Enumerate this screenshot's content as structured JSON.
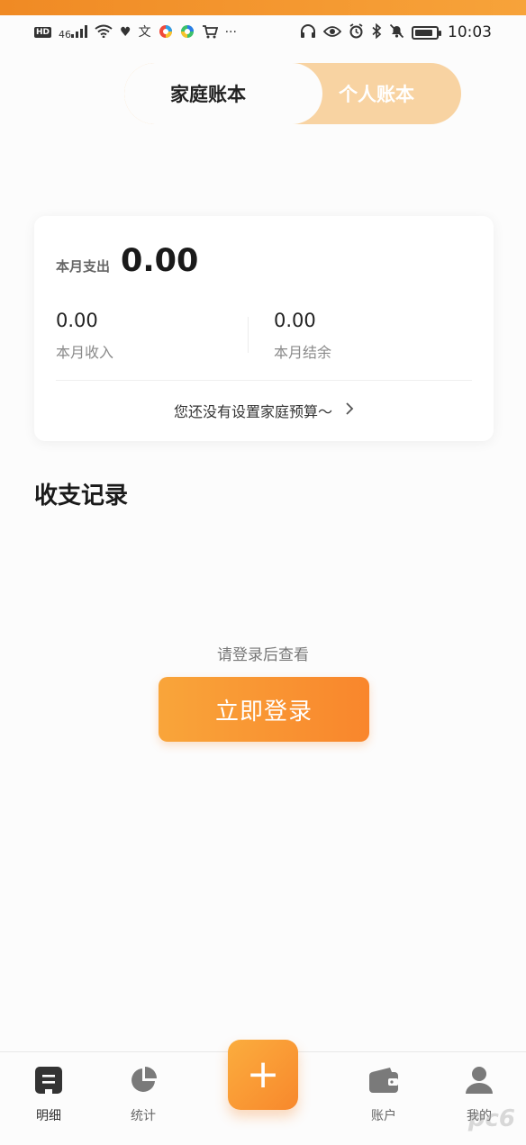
{
  "status_bar": {
    "left_icons": [
      "hd-badge-icon",
      "signal-icon",
      "wifi-icon",
      "health-icon",
      "translate-icon",
      "app-icon",
      "app-icon",
      "cart-icon",
      "more-icon"
    ],
    "hd": "HD",
    "network": "46",
    "more": "···",
    "time": "10:03",
    "battery_level": 0.85
  },
  "book_switch": {
    "active": "家庭账本",
    "inactive": "个人账本"
  },
  "summary": {
    "expense_label": "本月支出",
    "expense_value": "0.00",
    "income_value": "0.00",
    "income_label": "本月收入",
    "balance_value": "0.00",
    "balance_label": "本月结余",
    "budget_hint": "您还没有设置家庭预算～"
  },
  "records": {
    "title": "收支记录",
    "login_hint": "请登录后查看",
    "login_button": "立即登录"
  },
  "tabbar": {
    "tabs": [
      {
        "label": "明细"
      },
      {
        "label": "统计"
      },
      {
        "label": "账户"
      },
      {
        "label": "我的"
      }
    ],
    "add_symbol": "+"
  },
  "watermark": "pc6",
  "colors": {
    "accent": "#f9862c",
    "accent_light": "#f8d3a2"
  }
}
